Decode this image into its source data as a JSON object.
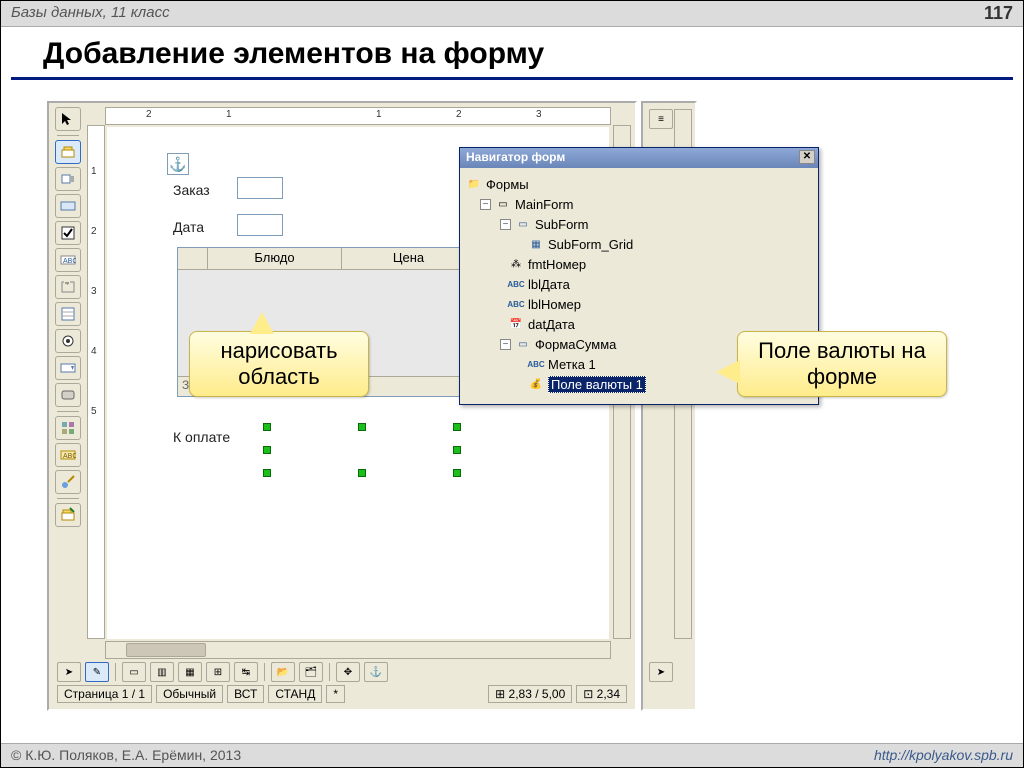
{
  "header": {
    "subject": "Базы данных, 11 класс",
    "page_no": "117"
  },
  "title": "Добавление элементов на форму",
  "footer": {
    "copyright": "© К.Ю. Поляков, Е.А. Ерёмин, 2013",
    "url": "http://kpolyakov.spb.ru"
  },
  "form": {
    "labels": {
      "order": "Заказ",
      "date": "Дата",
      "pay": "К оплате",
      "record": "Запись"
    },
    "grid_cols": {
      "dish": "Блюдо",
      "price": "Цена"
    }
  },
  "ruler": {
    "marks": [
      "2",
      "1",
      "1",
      "2",
      "3"
    ]
  },
  "navigator": {
    "title": "Навигатор форм",
    "root": "Формы",
    "items": {
      "main": "MainForm",
      "sub": "SubForm",
      "subgrid": "SubForm_Grid",
      "fmt": "fmtНомер",
      "lbldate": "lblДата",
      "lblnum": "lblНомер",
      "datdate": "datДата",
      "formsum": "ФормаСумма",
      "label1": "Метка 1",
      "currency": "Поле валюты 1"
    }
  },
  "callouts": {
    "draw": "нарисовать область",
    "field": "Поле валюты на форме"
  },
  "status": {
    "page": "Страница  1 / 1",
    "view": "Обычный",
    "ins": "ВСТ",
    "caps": "СТАНД",
    "mod": "*",
    "coords": "2,83 / 5,00",
    "size": "2,34"
  }
}
